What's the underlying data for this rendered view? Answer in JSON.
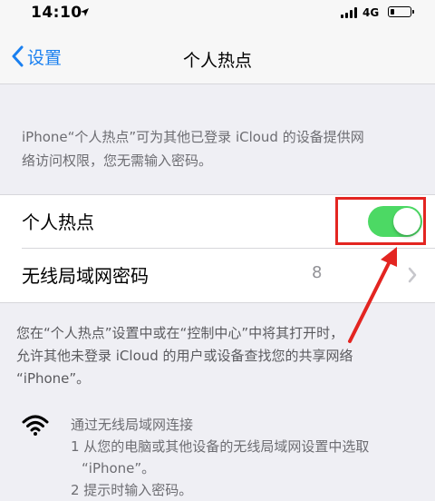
{
  "status_bar": {
    "time": "14:10",
    "network": "4G",
    "icons": [
      "location-arrow-icon",
      "signal-bars-icon",
      "battery-icon"
    ]
  },
  "nav": {
    "back_label": "设置",
    "title": "个人热点"
  },
  "description": {
    "line1": "iPhone“个人热点”可为其他已登录 iCloud 的设备提供网",
    "line2": "络访问权限，您无需输入密码。"
  },
  "settings": {
    "hotspot_label": "个人热点",
    "hotspot_enabled": true,
    "wifi_password_label": "无线局域网密码",
    "wifi_password_value": "8"
  },
  "hint": {
    "line1": "您在“个人热点”设置中或在“控制中心”中将其打开时，",
    "line2": "允许其他未登录 iCloud 的用户或设备查找您的共享网络",
    "line3": "“iPhone”。"
  },
  "connect": {
    "title": "通过无线局域网连接",
    "step1_line1": "1 从您的电脑或其他设备的无线局域网设置中选取",
    "step1_line2": "“iPhone”。",
    "step2": "2 提示时输入密码。"
  },
  "colors": {
    "accent": "#1a80f0",
    "toggle_on": "#4cd964",
    "annotation": "#e32521",
    "background": "#efeff4"
  }
}
